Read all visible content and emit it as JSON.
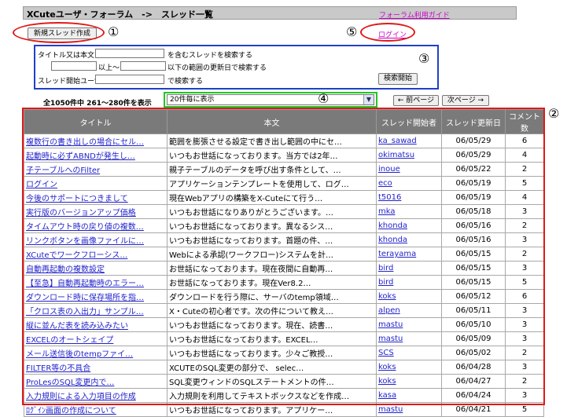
{
  "header": {
    "title": "XCuteユーザ・フォーラム　->　スレッド一覧",
    "guide_link": "フォーラム利用ガイド"
  },
  "toolbar": {
    "new_thread": "新規スレッド作成",
    "login": "ログイン"
  },
  "markers": {
    "m1": "①",
    "m2": "②",
    "m3": "③",
    "m4": "④",
    "m5": "⑤"
  },
  "search": {
    "row1_label": "タイトル又は本文に",
    "row1_suffix": "を含むスレッドを検索する",
    "row2_mid": "以上～",
    "row2_suffix": "以下の範囲の更新日で検索する",
    "row3_label": "スレッド開始ユーザ",
    "row3_suffix": "で検索する",
    "button": "検索開始"
  },
  "pager": {
    "summary": "全1050件中 261～280件を表示",
    "per_page": "20件毎に表示",
    "prev": "← 前ページ",
    "next": "次ページ →"
  },
  "table": {
    "headers": [
      "タイトル",
      "本文",
      "スレッド開始者",
      "スレッド更新日",
      "コメント数"
    ],
    "rows": [
      [
        "複数行の書き出しの場合にセル…",
        "範囲を膨張させる設定で書き出し範囲の中にセ…",
        "ka_sawad",
        "06/05/29",
        "6"
      ],
      [
        "起動時に必ずABNDが発生し…",
        "いつもお世話になっております。当方では2年…",
        "okimatsu",
        "06/05/29",
        "4"
      ],
      [
        "子テーブルへのFilter",
        "親子テーブルのデータを呼び出す条件として、…",
        "inoue",
        "06/05/22",
        "2"
      ],
      [
        "ログイン",
        "アプリケーションテンプレートを使用して、ログ…",
        "eco",
        "06/05/19",
        "5"
      ],
      [
        "今後のサポートにつきまして",
        "現在Webアプリの構築をX-Cuteにて行う…",
        "t5016",
        "06/05/19",
        "4"
      ],
      [
        "実行版のバージョンアップ価格",
        "いつもお世話になりありがとうございます。…",
        "mka",
        "06/05/18",
        "3"
      ],
      [
        "タイムアウト時の戻り値の複数…",
        "いつもお世話になっております。異なるシス…",
        "khonda",
        "06/05/16",
        "2"
      ],
      [
        "リンクボタンを画像ファイルに…",
        "いつもお世話になっております。首題の件、…",
        "khonda",
        "06/05/16",
        "3"
      ],
      [
        "XCuteでワークフローシス…",
        "Webによる承認(ワークフロー)システムを計…",
        "terayama",
        "06/05/15",
        "2"
      ],
      [
        "自動再起動の複数設定",
        "お世話になっております。現在夜間に自動再…",
        "bird",
        "06/05/15",
        "3"
      ],
      [
        "【至急】自動再起動時のエラー…",
        "お世話になっております。現在Ver8.2…",
        "bird",
        "06/05/15",
        "5"
      ],
      [
        "ダウンロード時に保存場所を指…",
        "ダウンロードを行う際に、サーバのtemp領域…",
        "koks",
        "06/05/12",
        "6"
      ],
      [
        "「クロス表の入出力」サンプル…",
        "X・Cuteの初心者です。次の件について教え…",
        "alpen",
        "06/05/11",
        "3"
      ],
      [
        "縦に並んだ表を読み込みたい",
        "いつもお世話になっております。現在、読書…",
        "mastu",
        "06/05/10",
        "3"
      ],
      [
        "EXCELのオートシェイプ",
        "いつもお世話になっております。EXCEL…",
        "mastu",
        "06/05/09",
        "3"
      ],
      [
        "メール送信後のtempファイ…",
        "いつもお世話になっております。少々ご教授…",
        "SCS",
        "06/05/02",
        "2"
      ],
      [
        "FILTER等の不具合",
        "XCUTEのSQL変更の部分で、 selec…",
        "koks",
        "06/04/28",
        "3"
      ],
      [
        "ProLesのSQL変更内で…",
        "SQL変更ウィンドのSQLステートメントの件…",
        "koks",
        "06/04/27",
        "2"
      ],
      [
        "入力規則による入力項目の作成",
        "入力規則を利用してテキストボックスなどを作成…",
        "kasa",
        "06/04/24",
        "3"
      ],
      [
        "ﾛｸﾞｲﾝ画面の作成について",
        "いつもお世話になっております。アプリケー…",
        "mastu",
        "06/04/21",
        "5"
      ]
    ]
  },
  "colors": {
    "annotation_red": "#e01818",
    "annotation_blue": "#2040c8",
    "annotation_green": "#20c820",
    "header_gray": "#7a7a7a",
    "link_blue": "#2222cc",
    "link_magenta": "#cc00cc"
  }
}
